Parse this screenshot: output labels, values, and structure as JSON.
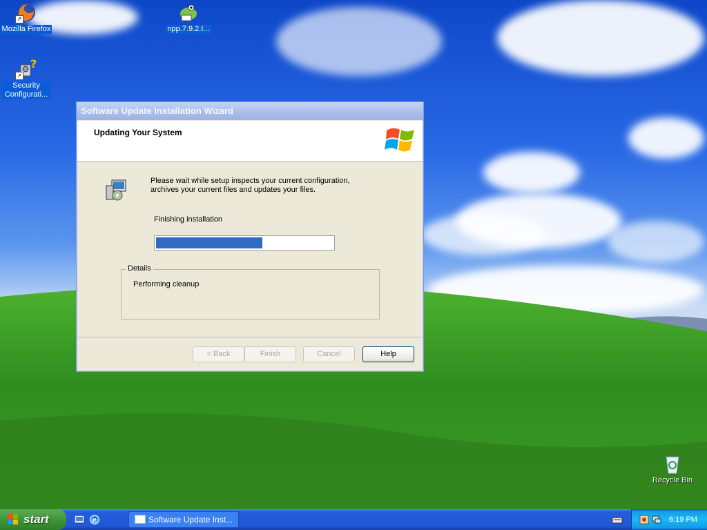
{
  "desktop": {
    "icons": [
      {
        "name": "firefox",
        "label": "Mozilla Firefox"
      },
      {
        "name": "notepadpp",
        "label": "npp.7.9.2.I..."
      },
      {
        "name": "security",
        "label": "Security Configurati..."
      },
      {
        "name": "recycle",
        "label": "Recycle Bin"
      }
    ]
  },
  "wizard": {
    "title": "Software Update Installation Wizard",
    "header_title": "Updating Your System",
    "message": "Please wait while setup inspects your current configuration, archives your current files and updates your files.",
    "status": "Finishing installation",
    "progress": 0.6,
    "details_legend": "Details",
    "details_text": "Performing cleanup",
    "buttons": {
      "back": "< Back",
      "finish": "Finish",
      "cancel": "Cancel",
      "help": "Help"
    }
  },
  "taskbar": {
    "start_label": "start",
    "task_label": "Software Update Inst...",
    "clock": "6:19 PM"
  },
  "colors": {
    "progress_fill": "#316ac5",
    "taskbar": "#245edb",
    "start": "#3c9636"
  }
}
